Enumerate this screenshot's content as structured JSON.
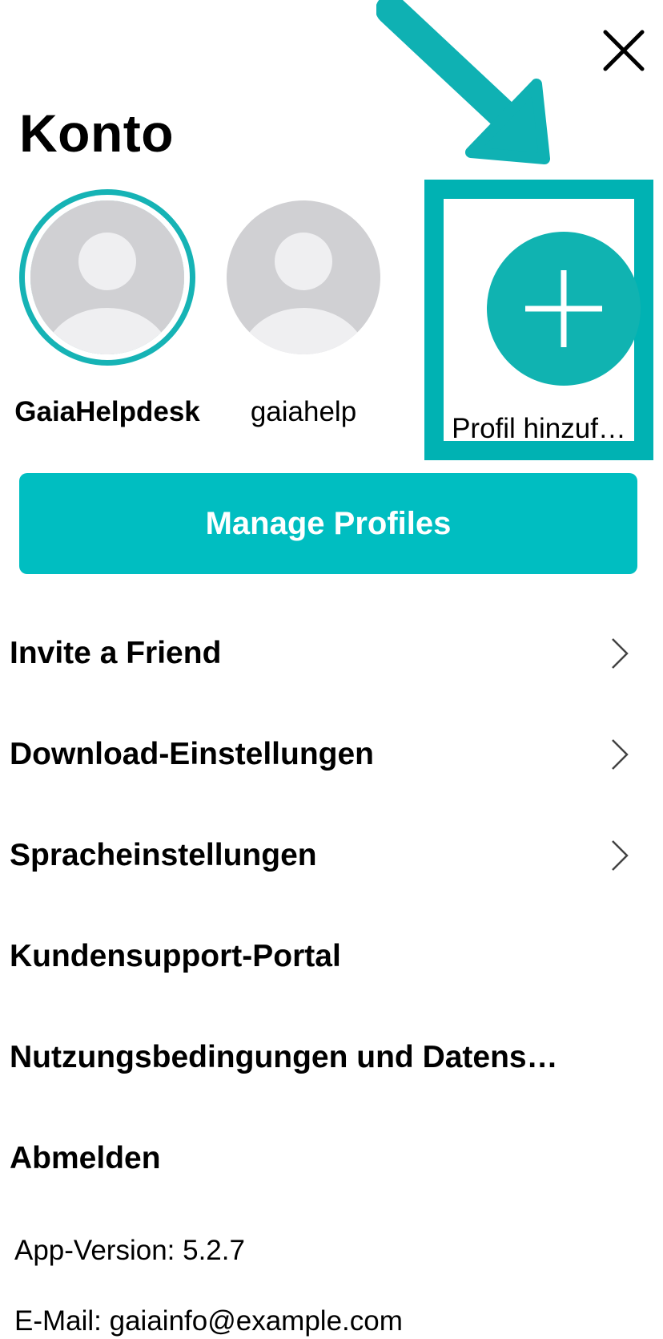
{
  "header": {
    "title": "Konto",
    "close_icon": "close-icon"
  },
  "profiles": [
    {
      "name": "GaiaHelpdesk",
      "selected": true,
      "icon": "person-avatar-icon"
    },
    {
      "name": "gaiahelp",
      "selected": false,
      "icon": "person-avatar-icon"
    }
  ],
  "add_profile": {
    "label": "Profil hinzuf…",
    "icon": "plus-icon"
  },
  "manage_profiles_label": "Manage Profiles",
  "menu": {
    "items": [
      {
        "label": "Invite a Friend",
        "has_chevron": true
      },
      {
        "label": "Download-Einstellungen",
        "has_chevron": true
      },
      {
        "label": "Spracheinstellungen",
        "has_chevron": true
      },
      {
        "label": "Kundensupport-Portal",
        "has_chevron": false
      },
      {
        "label": "Nutzungsbedingungen und Datens…",
        "has_chevron": false
      },
      {
        "label": "Abmelden",
        "has_chevron": false
      }
    ]
  },
  "footer": {
    "app_version": "App-Version: 5.2.7",
    "email": "E-Mail: gaiainfo@example.com"
  },
  "colors": {
    "accent": "#00bec1",
    "highlight": "#00b2b3",
    "selected_ring": "#16b3b5",
    "avatar_bg": "#d0d0d3",
    "avatar_fg": "#efeff1"
  }
}
